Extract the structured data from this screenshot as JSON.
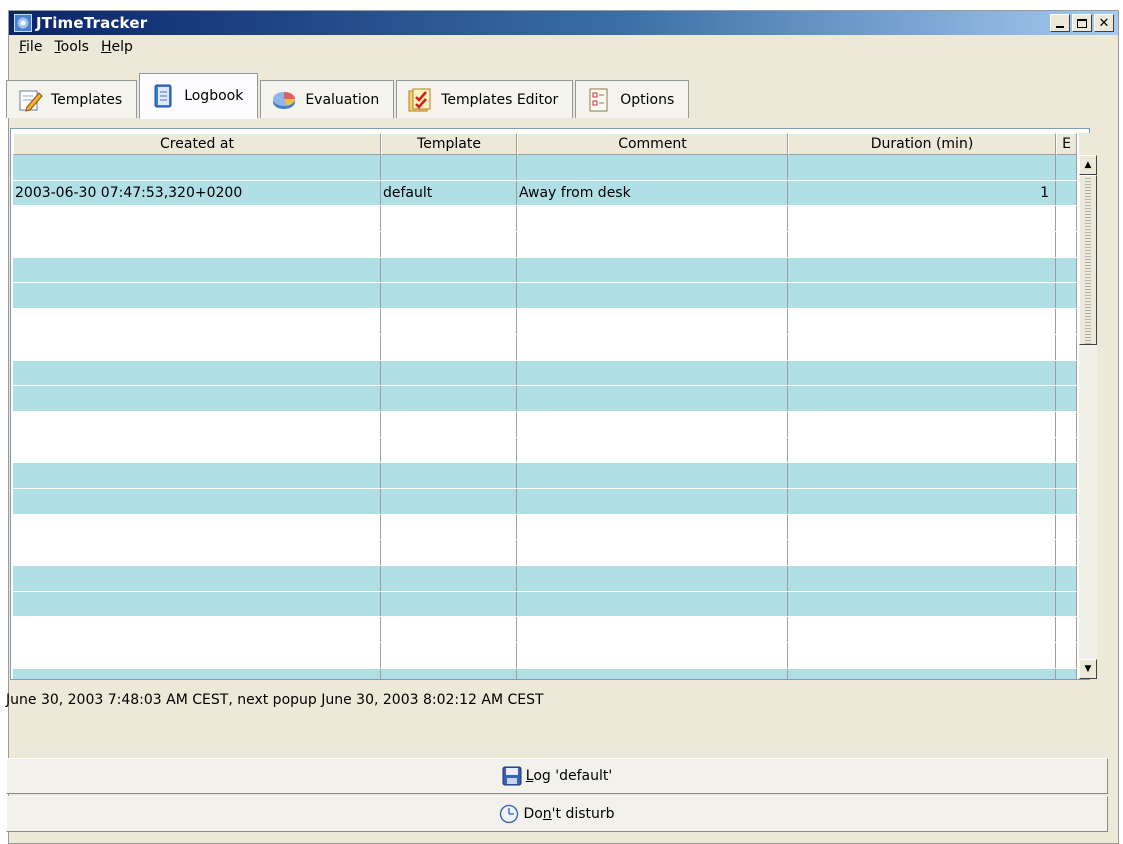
{
  "window": {
    "title": "JTimeTracker"
  },
  "menu": [
    {
      "pre": "",
      "u": "F",
      "post": "ile"
    },
    {
      "pre": "",
      "u": "T",
      "post": "ools"
    },
    {
      "pre": "",
      "u": "H",
      "post": "elp"
    }
  ],
  "tabs": [
    {
      "label": "Templates",
      "icon": "templates-icon"
    },
    {
      "label": "Logbook",
      "icon": "logbook-icon"
    },
    {
      "label": "Evaluation",
      "icon": "pie-chart-icon"
    },
    {
      "label": "Templates Editor",
      "icon": "templates-editor-icon"
    },
    {
      "label": "Options",
      "icon": "options-icon"
    }
  ],
  "table": {
    "columns": [
      "Created at",
      "Template",
      "Comment",
      "Duration (min)",
      "E"
    ],
    "row": {
      "created_at": "2003-06-30 07:47:53,320+0200",
      "template": "default",
      "comment": "Away from desk",
      "duration": "1"
    }
  },
  "status_text": "June 30, 2003 7:48:03 AM CEST, next popup June 30, 2003 8:02:12 AM CEST",
  "buttons": {
    "log": {
      "pre": "",
      "u": "L",
      "post": "og 'default'"
    },
    "dnd": {
      "pre": "Do",
      "u": "n",
      "post": "'t disturb"
    }
  },
  "colors": {
    "row_highlight": "#b0e0e6",
    "title_start": "#0a246a",
    "title_end": "#a6caf0"
  }
}
